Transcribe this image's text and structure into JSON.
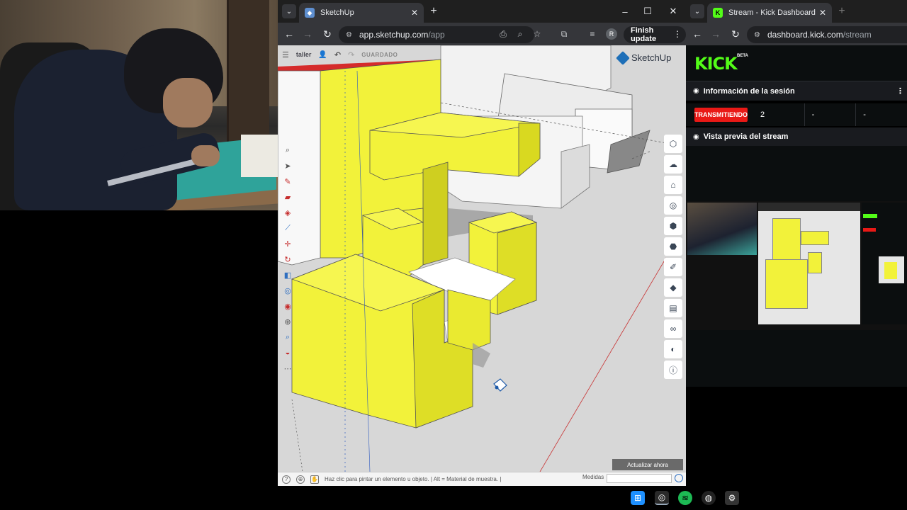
{
  "browser_left": {
    "tab_title": "SketchUp",
    "url_host": "app.sketchup.com",
    "url_path": "/app",
    "finish_update": "Finish update",
    "profile_initial": "R"
  },
  "sketchup": {
    "file_name": "taller",
    "save_state": "GUARDADO",
    "brand": "SketchUp",
    "update_button": "Actualizar ahora",
    "status_text": "Haz clic para pintar un elemento u objeto. | Alt = Material de muestra. |",
    "measurements_label": "Medidas",
    "accent_yellow": "#f5f53a",
    "accent_red": "#d52b2b"
  },
  "browser_right": {
    "tab_title": "Stream - Kick Dashboard",
    "url_host": "dashboard.kick.com",
    "url_path": "/stream"
  },
  "kick": {
    "logo": "KICK",
    "beta": "BETA",
    "session_title": "Información de la sesión",
    "live_badge": "TRANSMITIENDO",
    "stat_1": "2",
    "stat_2": "-",
    "stat_3": "-",
    "preview_title": "Vista previa del stream",
    "brand_color": "#53fc18",
    "live_color": "#e91916"
  },
  "icons": {
    "left_tools": [
      "search-icon",
      "select-icon",
      "pencil-icon",
      "eraser-icon",
      "paint-bucket-icon",
      "line-icon",
      "move-icon",
      "rotate-icon",
      "scale-icon",
      "push-pull-icon",
      "tape-icon",
      "orbit-icon",
      "zoom-icon",
      "section-icon",
      "more-icon"
    ],
    "right_tools": [
      "components-icon",
      "materials-icon",
      "styles-icon",
      "scenes-icon",
      "outliner-icon",
      "entity-info-icon",
      "soften-icon",
      "tags-icon",
      "scene-icon",
      "glasses-icon",
      "display-icon",
      "info-icon"
    ]
  }
}
